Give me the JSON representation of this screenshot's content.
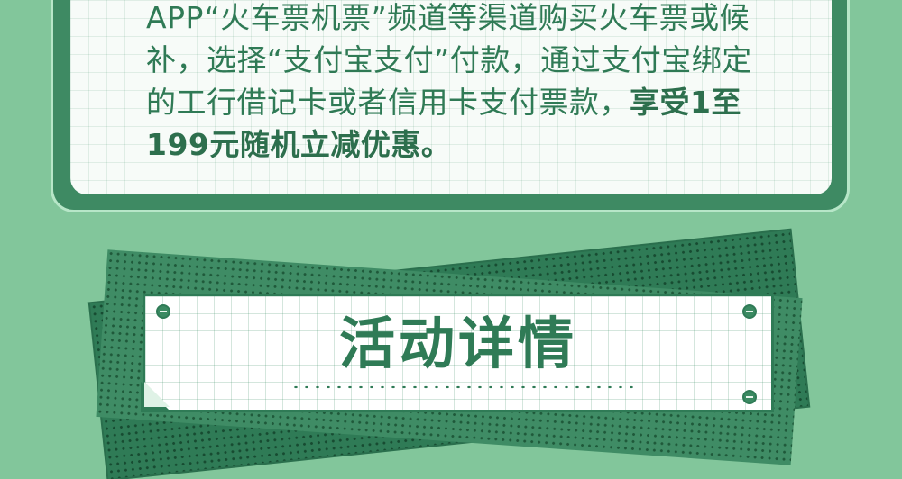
{
  "description": {
    "text_normal": "APP“火车票机票”频道等渠道购买火车票或候补，选择“支付宝支付”付款，通过支付宝绑定的工行借记卡或者信用卡支付票款，",
    "text_bold": "享受1至199元随机立减优惠。"
  },
  "section": {
    "title": "活动详情"
  },
  "colors": {
    "background": "#82c69b",
    "primary_green": "#2f7b56",
    "card_white": "#f7fbf8"
  }
}
